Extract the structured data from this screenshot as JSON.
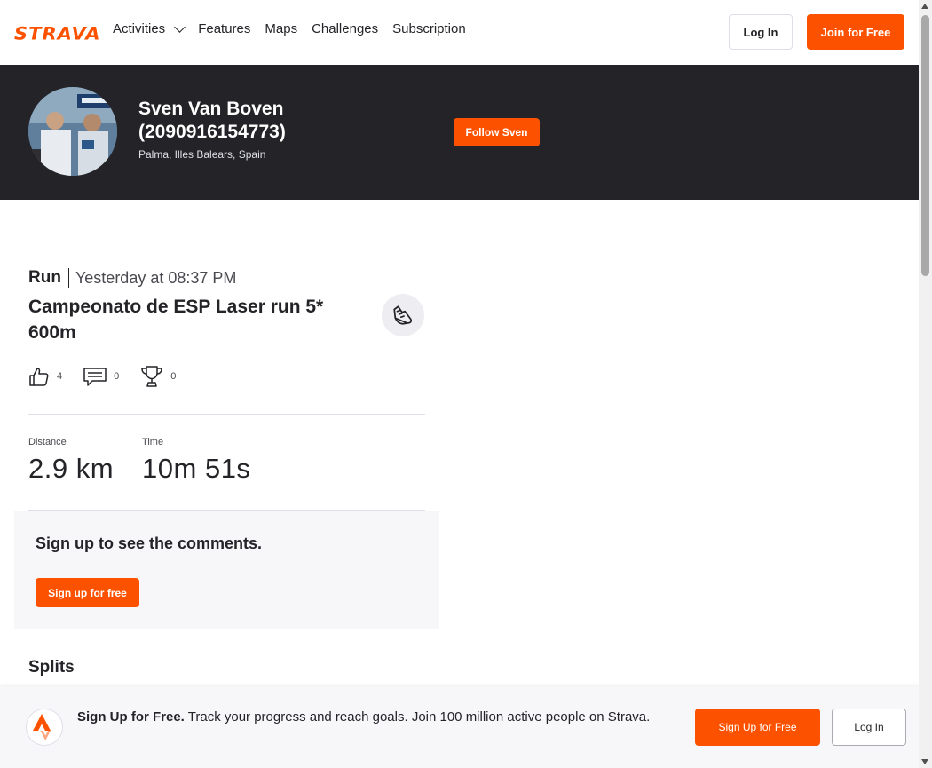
{
  "nav": {
    "logo": "STRAVA",
    "links": [
      "Activities",
      "Features",
      "Maps",
      "Challenges",
      "Subscription"
    ],
    "login_label": "Log In",
    "join_label": "Join for Free"
  },
  "athlete": {
    "name": "Sven Van Boven (2090916154773)",
    "location": "Palma, Illes Balears, Spain",
    "follow_label": "Follow Sven"
  },
  "activity": {
    "type": "Run",
    "date": "Yesterday at 08:37 PM",
    "title": "Campeonato de ESP Laser run 5* 600m",
    "sport_icon": "running-shoe-icon",
    "kudos": "4",
    "comments": "0",
    "achievements": "0",
    "stats": [
      {
        "label": "Distance",
        "value": "2.9 km"
      },
      {
        "label": "Time",
        "value": "10m 51s"
      }
    ]
  },
  "comments_cta": {
    "heading": "Sign up to see the comments.",
    "button": "Sign up for free"
  },
  "splits": {
    "title": "Splits"
  },
  "banner": {
    "headline": "Sign Up for Free.",
    "body": "Track your progress and reach goals. Join 100 million active people on Strava.",
    "signup_label": "Sign Up for Free",
    "login_label": "Log In"
  },
  "colors": {
    "brand": "#fc5200",
    "dark": "#242428"
  }
}
